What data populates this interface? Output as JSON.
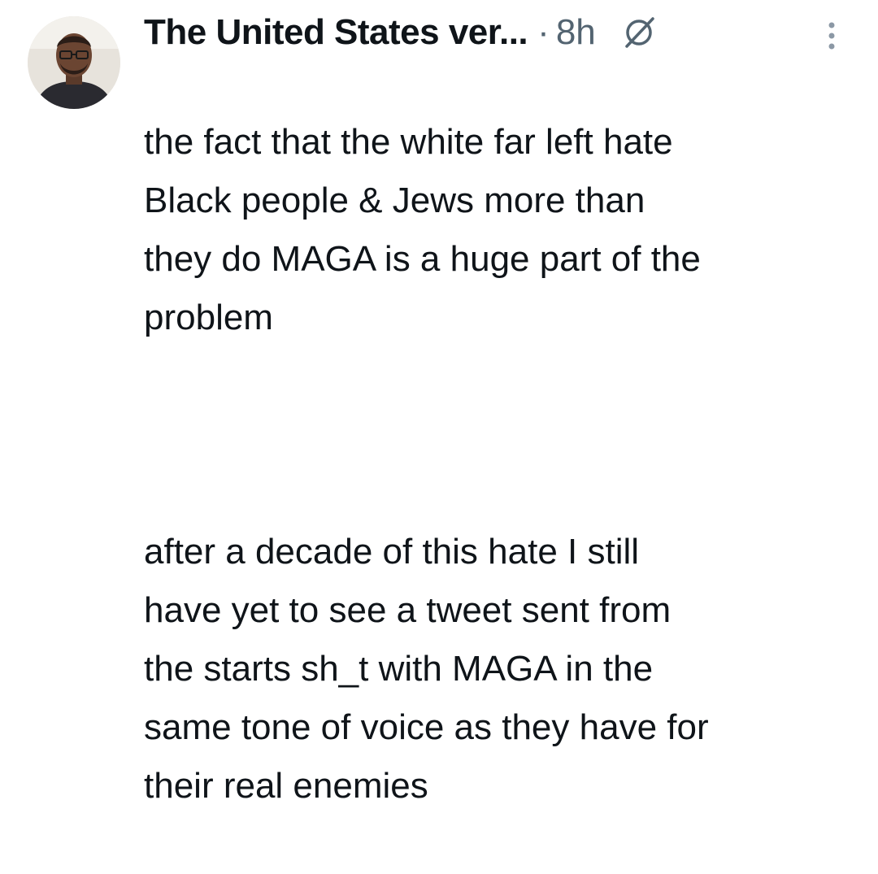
{
  "tweet": {
    "author": {
      "display_name": "The United States ver...",
      "avatar_icon": "profile-photo"
    },
    "separator": "·",
    "timestamp": "8h",
    "grok_icon": "grok-slash-circle-icon",
    "more_icon": "vertical-ellipsis-icon",
    "paragraph_1": "the fact that the white far left hate\nBlack people & Jews more than\nthey do MAGA is a huge part of the\nproblem",
    "paragraph_2": "after a decade of this hate I still\nhave yet to see a tweet sent from\nthe starts sh_t with MAGA in the\nsame tone of voice as they have for\ntheir real enemies"
  },
  "colors": {
    "text": "#0f1419",
    "secondary": "#536471",
    "background": "#ffffff"
  }
}
